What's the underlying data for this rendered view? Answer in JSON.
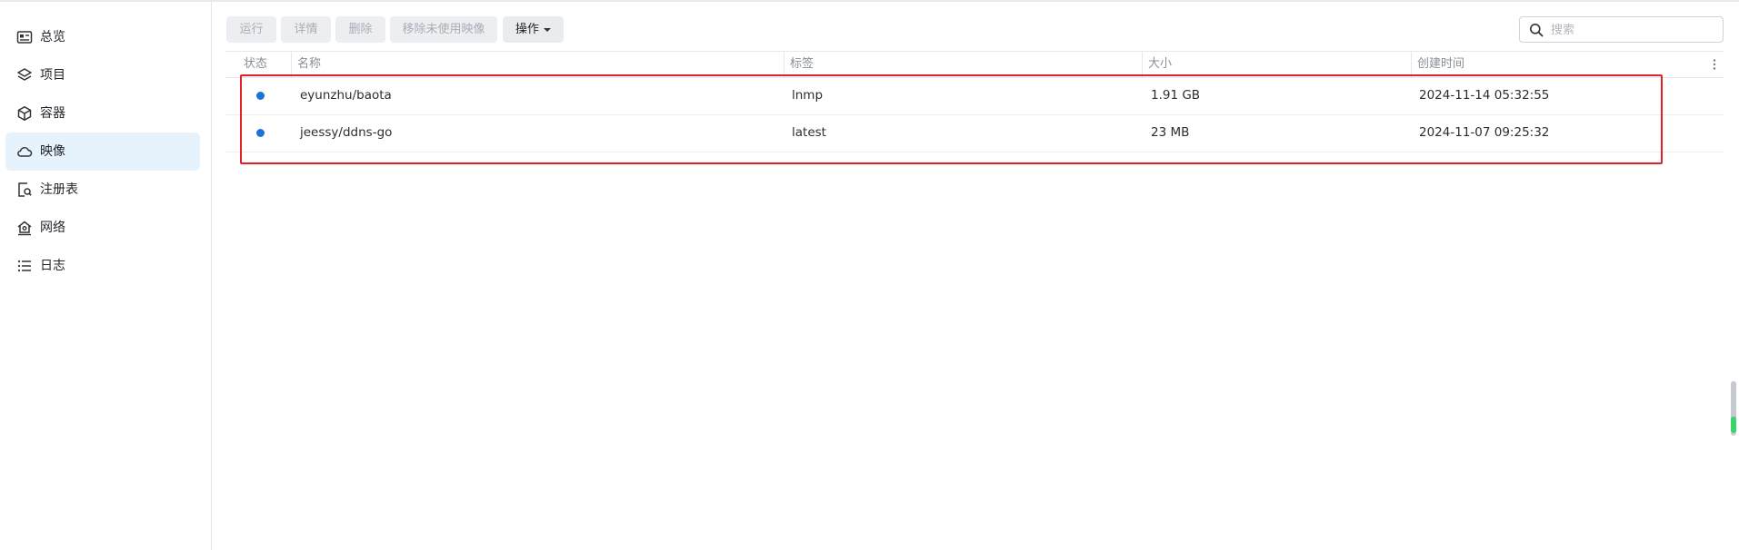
{
  "sidebar": {
    "items": [
      {
        "label": "总览",
        "icon": "dashboard-icon",
        "active": false
      },
      {
        "label": "项目",
        "icon": "layers-icon",
        "active": false
      },
      {
        "label": "容器",
        "icon": "cube-icon",
        "active": false
      },
      {
        "label": "映像",
        "icon": "cloud-icon",
        "active": true
      },
      {
        "label": "注册表",
        "icon": "registry-search-icon",
        "active": false
      },
      {
        "label": "网络",
        "icon": "network-home-icon",
        "active": false
      },
      {
        "label": "日志",
        "icon": "list-icon",
        "active": false
      }
    ]
  },
  "toolbar": {
    "run_label": "运行",
    "details_label": "详情",
    "delete_label": "删除",
    "remove_unused_label": "移除未使用映像",
    "actions_label": "操作"
  },
  "search": {
    "placeholder": "搜索"
  },
  "table": {
    "headers": {
      "status": "状态",
      "name": "名称",
      "tag": "标签",
      "size": "大小",
      "created": "创建时间"
    },
    "rows": [
      {
        "name": "eyunzhu/baota",
        "tag": "lnmp",
        "size": "1.91 GB",
        "created": "2024-11-14 05:32:55",
        "status_color": "#1a73d9"
      },
      {
        "name": "jeessy/ddns-go",
        "tag": "latest",
        "size": "23 MB",
        "created": "2024-11-07 09:25:32",
        "status_color": "#1a73d9"
      }
    ]
  },
  "colors": {
    "accent": "#1a73d9",
    "active_nav_bg": "#e6f2fc",
    "highlight": "#e3202a"
  }
}
